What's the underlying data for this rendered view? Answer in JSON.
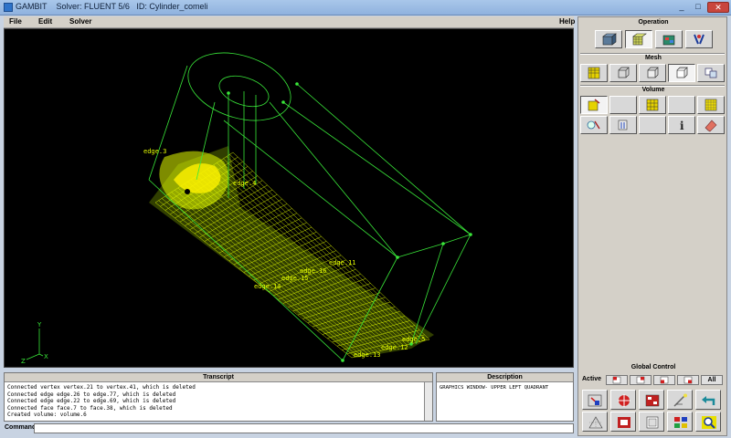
{
  "window": {
    "app_name": "GAMBIT",
    "solver": "Solver: FLUENT 5/6",
    "id": "ID: Cylinder_comeli",
    "minimize_glyph": "_",
    "maximize_glyph": "□",
    "close_glyph": "✕"
  },
  "menu": {
    "file": "File",
    "edit": "Edit",
    "solver": "Solver",
    "help": "Help"
  },
  "graphics": {
    "labels": {
      "edge3": "edge.3",
      "edge4": "edge.4",
      "edge11": "edge.11",
      "edge16": "edge.16",
      "edge15": "edge.15",
      "edge14": "edge.14",
      "edge5": "edge.5",
      "edge12": "edge.12",
      "edge13": "edge.13"
    },
    "axes": {
      "y": "Y",
      "x": "X",
      "z": "Z"
    },
    "wire_color": "#39e639",
    "mesh_color": "#e6ff00",
    "label_color": "#e6ff00"
  },
  "panel": {
    "operation_label": "Operation",
    "mesh_label": "Mesh",
    "volume_label": "Volume",
    "global_control_label": "Global Control",
    "active_label": "Active",
    "all_label": "All"
  },
  "transcript": {
    "title": "Transcript",
    "lines": [
      "Connected vertex vertex.21 to vertex.41, which is deleted",
      "Connected edge edge.26 to edge.77, which is deleted",
      "Connected edge edge.22 to edge.69, which is deleted",
      "Connected face face.7 to face.38, which is deleted",
      "Created volume: volume.6"
    ]
  },
  "description": {
    "title": "Description",
    "text": "GRAPHICS WINDOW- UPPER LEFT QUADRANT"
  },
  "command": {
    "label": "Command:",
    "value": ""
  }
}
